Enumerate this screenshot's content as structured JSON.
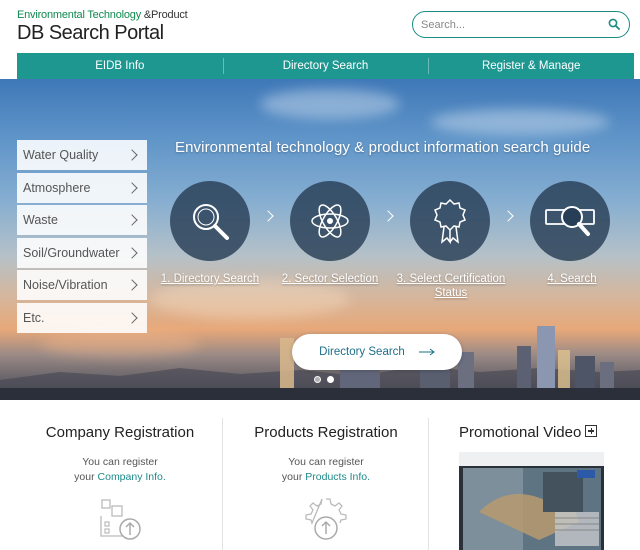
{
  "header": {
    "logo_line1_green": "Environmental Technology",
    "logo_line1_amp": " &Product",
    "logo_line2": "DB Search Portal",
    "search_placeholder": "Search..."
  },
  "nav": {
    "items": [
      "EIDB Info",
      "Directory Search",
      "Register & Manage"
    ]
  },
  "side_menu": {
    "items": [
      "Water Quality",
      "Atmosphere",
      "Waste",
      "Soil/Groundwater",
      "Noise/Vibration",
      "Etc."
    ]
  },
  "guide": {
    "title": "Environmental technology & product information search guide",
    "steps": [
      {
        "label": "1. Directory Search",
        "icon": "magnifier-icon"
      },
      {
        "label": "2. Sector Selection",
        "icon": "atom-icon"
      },
      {
        "label": "3. Select Certification Status",
        "icon": "ribbon-badge-icon"
      },
      {
        "label": "4. Search",
        "icon": "magnifier-bar-icon"
      }
    ],
    "button_label": "Directory Search"
  },
  "bottom": {
    "company": {
      "title": "Company Registration",
      "line1": "You can register",
      "line2_prefix": "your ",
      "line2_highlight": "Company Info.",
      "icon": "factory-upload-icon"
    },
    "products": {
      "title": "Products Registration",
      "line1": "You can register",
      "line2_prefix": "your ",
      "line2_highlight": "Products Info.",
      "icon": "gear-upload-icon"
    },
    "promo": {
      "title": "Promotional Video",
      "icon": "plus-box-icon"
    }
  },
  "colors": {
    "accent": "#1e9790",
    "logo_green": "#0f8a4f",
    "highlight": "#1e8a8a"
  }
}
